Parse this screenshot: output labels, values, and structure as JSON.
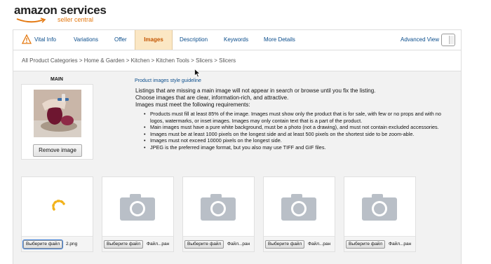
{
  "header": {
    "logo_main": "amazon services",
    "logo_sub": "seller central"
  },
  "tabs": [
    {
      "label": "Vital Info",
      "icon": "warning-icon"
    },
    {
      "label": "Variations"
    },
    {
      "label": "Offer"
    },
    {
      "label": "Images",
      "active": true
    },
    {
      "label": "Description"
    },
    {
      "label": "Keywords"
    },
    {
      "label": "More Details"
    }
  ],
  "advanced_view_label": "Advanced View",
  "breadcrumb": "All Product Categories > Home & Garden > Kitchen > Kitchen Tools > Slicers > Slicers",
  "main_image": {
    "label": "MAIN",
    "remove_label": "Remove image"
  },
  "guideline_link": "Product images style guideline",
  "intro_lines": [
    "Listings that are missing a main image will not appear in search or browse until you fix the listing.",
    "Choose images that are clear, information-rich, and attractive.",
    "Images must meet the following requirements:"
  ],
  "requirements": [
    "Products must fill at least 85% of the image. Images must show only the product that is for sale, with few or no props and with no logos, watermarks, or inset images. Images may only contain text that is a part of the product.",
    "Main images must have a pure white background, must be a photo (not a drawing), and must not contain excluded accessories.",
    "Images must be at least 1000 pixels on the longest side and at least 500 pixels on the shortest side to be zoom-able.",
    "Images must not exceed 10000 pixels on the longest side.",
    "JPEG is the preferred image format, but you also may use TIFF and GIF files."
  ],
  "slots": [
    {
      "button": "Выберите файл",
      "file": "2.png",
      "state": "loading"
    },
    {
      "button": "Выберите файл",
      "file": "Файл...ран",
      "state": "empty"
    },
    {
      "button": "Выберите файл",
      "file": "Файл...ран",
      "state": "empty"
    },
    {
      "button": "Выберите файл",
      "file": "Файл...ран",
      "state": "empty"
    },
    {
      "button": "Выберите файл",
      "file": "Файл...ран",
      "state": "empty"
    }
  ],
  "colors": {
    "link": "#0a4d8c",
    "active_tab_bg": "#fbe7c4",
    "active_tab_text": "#c45500",
    "brand_orange": "#e47911",
    "camera_gray": "#b9bfc7"
  }
}
